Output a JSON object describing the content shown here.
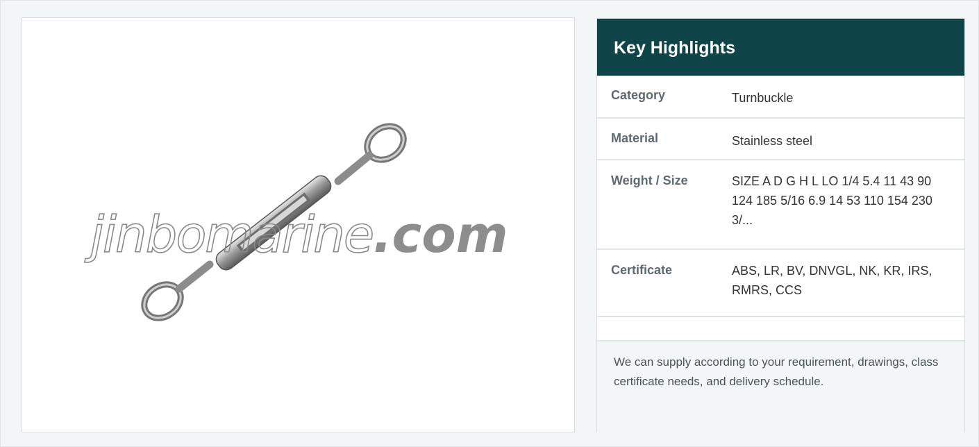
{
  "product_image": {
    "alt": "Stainless steel turnbuckle",
    "watermark_text": "jinbomarine",
    "watermark_domain": ".com"
  },
  "highlights": {
    "title": "Key Highlights",
    "rows": [
      {
        "label": "Category",
        "value": "Turnbuckle"
      },
      {
        "label": "Material",
        "value": "Stainless steel"
      },
      {
        "label": "Weight / Size",
        "value": "SIZE A D G H L LO 1/4 5.4 11 43 90 124 185 5/16 6.9 14 53 110 154 230 3/..."
      },
      {
        "label": "Certificate",
        "value": "ABS, LR, BV, DNVGL, NK, KR, IRS, RMRS, CCS"
      }
    ],
    "note": "We can supply according to your requirement, drawings, class certificate needs, and delivery schedule."
  }
}
